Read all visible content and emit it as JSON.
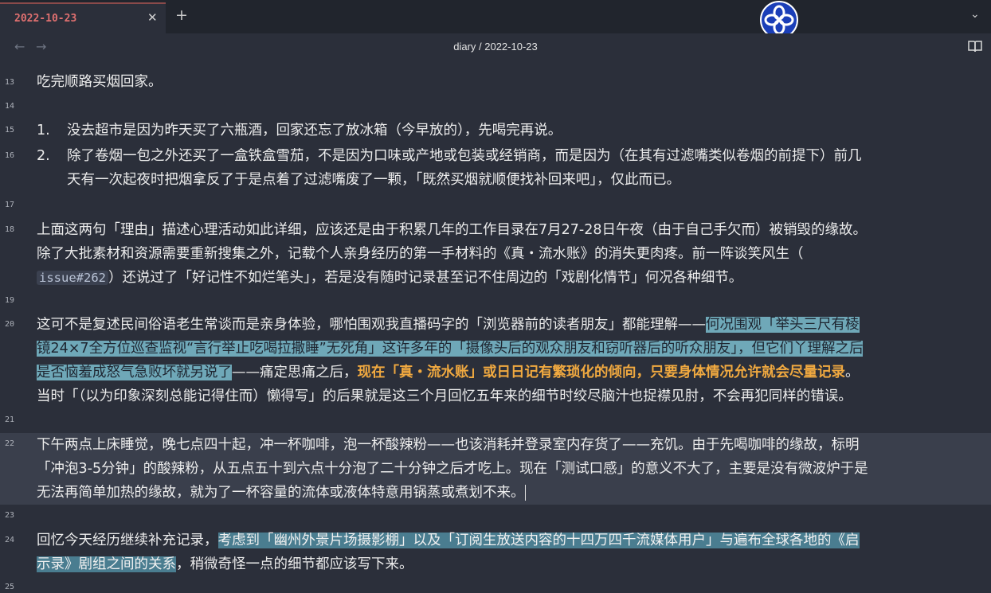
{
  "tab": {
    "title": "2022-10-23",
    "close_glyph": "✕",
    "new_glyph": "+",
    "menu_glyph": "⌄"
  },
  "nav": {
    "back_glyph": "←",
    "forward_glyph": "→",
    "breadcrumb": "diary / 2022-10-23"
  },
  "icons": {
    "logo": "flower-logo-icon",
    "reading_view": "book-open-icon",
    "accent_blue": "#1b3fb8",
    "highlight_cyan": "#6fa8b8",
    "highlight_selection": "#4a7d90",
    "emphasis_orange": "#f0a940"
  },
  "editor": {
    "line_numbers": [
      "13",
      "14",
      "15",
      "16",
      "17",
      "18",
      "19",
      "20",
      "21",
      "22",
      "23",
      "24",
      "25"
    ],
    "l13": "吃完顺路买烟回家。",
    "l15": {
      "num": "1.",
      "text": "没去超市是因为昨天买了六瓶酒，回家还忘了放冰箱（今早放的），先喝完再说。"
    },
    "l16": {
      "num": "2.",
      "row1": "除了卷烟一包之外还买了一盒铁盒雪茄，不是因为口味或产地或包装或经销商，而是因为（在其有过滤嘴类似卷烟的前提下）前几",
      "row2": "天有一次起夜时把烟拿反了于是点着了过滤嘴废了一颗，「既然买烟就顺便找补回来吧」，仅此而已。"
    },
    "l18": {
      "row1": "上面这两句「理由」描述心理活动如此详细，应该还是由于积累几年的工作目录在7月27-28日午夜（由于自己手欠而）被销毁的缘故。",
      "row2": "除了大批素材和资源需要重新搜集之外，记载个人亲身经历的第一手材料的《真・流水账》的消失更肉疼。前一阵谈笑风生（",
      "code": "issue#262",
      "row3_after": "）还说过了「好记性不如烂笔头」，若是没有随时记录甚至记不住周边的「戏剧化情节」何况各种细节。"
    },
    "l20": {
      "row1_a": "这可不是复述民间俗语老生常谈而是亲身体验，哪怕围观我直播码字的「浏览器前的读者朋友」都能理解——",
      "row1_hl": "何况围观「举头三尺有棱",
      "row2_hl": "镜24×7全方位巡查监视“言行举止吃喝拉撒睡”无死角」这许多年的「摄像头后的观众朋友和窃听器后的听众朋友」，但它们丫理解之后",
      "row3_hl": "是否恼羞成怒气急败坏就另说了",
      "row3_b": "——痛定思痛之后，",
      "row3_orange": "现在「真・流水账」或日日记有繁琐化的倾向，只要身体情况允许就会尽量记录",
      "row3_c": "。",
      "row4": "当时「（以为印象深刻总能记得住而）懒得写」的后果就是这三个月回忆五年来的细节时绞尽脑汁也捉襟见肘，不会再犯同样的错误。"
    },
    "l22": {
      "row1": "下午两点上床睡觉，晚七点四十起，冲一杯咖啡，泡一杯酸辣粉——也该消耗并登录室内存货了——充饥。由于先喝咖啡的缘故，标明",
      "row2": "「冲泡3-5分钟」的酸辣粉，从五点五十到六点十分泡了二十分钟之后才吃上。现在「测试口感」的意义不大了，主要是没有微波炉于是",
      "row3": "无法再简单加热的缘故，就为了一杯容量的流体或液体特意用锅蒸或煮划不来。"
    },
    "l24": {
      "row1_a": "回忆今天经历继续补充记录，",
      "row1_hl": "考虑到「幽州外景片场摄影棚」以及「订阅生放送内容的十四万四千流媒体用户」与遍布全球各地的《启",
      "row2_hl": "示录》剧组之间的关系",
      "row2_b": "，稍微奇怪一点的细节都应该写下来。"
    }
  }
}
